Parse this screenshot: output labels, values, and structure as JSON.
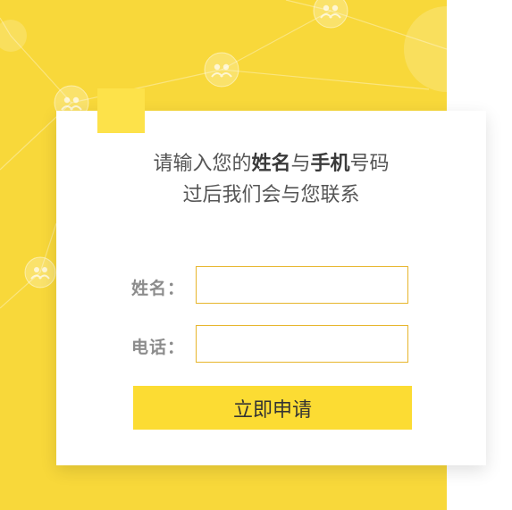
{
  "form": {
    "headline": {
      "line1_part1": "请输入您的",
      "line1_bold1": "姓名",
      "line1_part2": "与",
      "line1_bold2": "手机",
      "line1_part3": "号码",
      "line2": "过后我们会与您联系"
    },
    "name_label": "姓名：",
    "name_value": "",
    "phone_label": "电话：",
    "phone_value": "",
    "submit_label": "立即申请"
  },
  "theme": {
    "background_yellow": "#f8d83a",
    "accent_yellow": "#fde24a",
    "button_yellow": "#fcdc33",
    "input_border": "#e7b52c",
    "card_background": "#ffffff"
  },
  "icons": [
    "people-icon"
  ]
}
